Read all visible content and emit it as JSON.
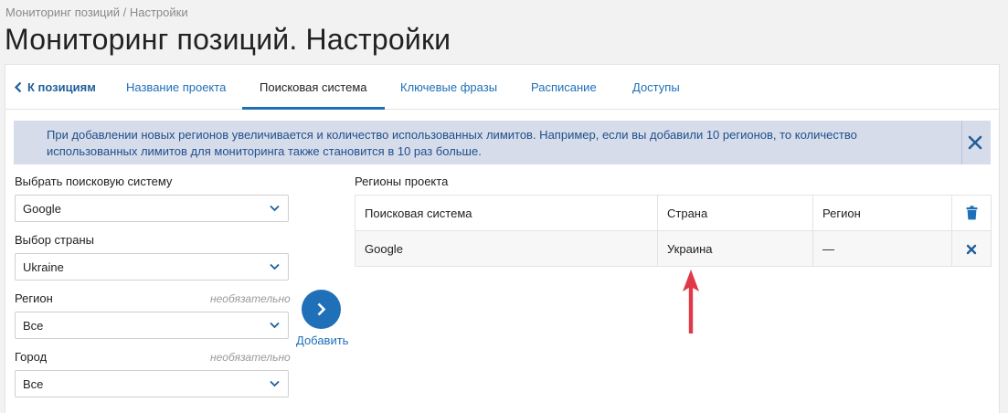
{
  "breadcrumb": "Мониторинг позиций / Настройки",
  "title": "Мониторинг позиций. Настройки",
  "tabs": {
    "back": "К позициям",
    "items": [
      "Название проекта",
      "Поисковая система",
      "Ключевые фразы",
      "Расписание",
      "Доступы"
    ],
    "active": "Поисковая система"
  },
  "alert": {
    "text": "При добавлении новых регионов увеличивается и количество использованных лимитов. Например, если вы добавили 10 регионов, то количество использованных лимитов для мониторинга также становится в 10 раз больше."
  },
  "form": {
    "engine_label": "Выбрать поисковую систему",
    "engine_value": "Google",
    "country_label": "Выбор страны",
    "country_value": "Ukraine",
    "region_label": "Регион",
    "region_value": "Все",
    "city_label": "Город",
    "city_value": "Все",
    "optional_text": "необязательно",
    "add_label": "Добавить"
  },
  "regions": {
    "title": "Регионы проекта",
    "columns": [
      "Поисковая система",
      "Страна",
      "Регион"
    ],
    "rows": [
      {
        "engine": "Google",
        "country": "Украина",
        "region": "—"
      }
    ]
  },
  "colors": {
    "accent": "#1f70b8",
    "alert_bg": "#d6dcea",
    "arrow": "#e0394a"
  },
  "icons": [
    "chevron-left-icon",
    "close-icon",
    "chevron-down-icon",
    "chevron-right-icon",
    "trash-icon",
    "arrow-up-icon"
  ]
}
